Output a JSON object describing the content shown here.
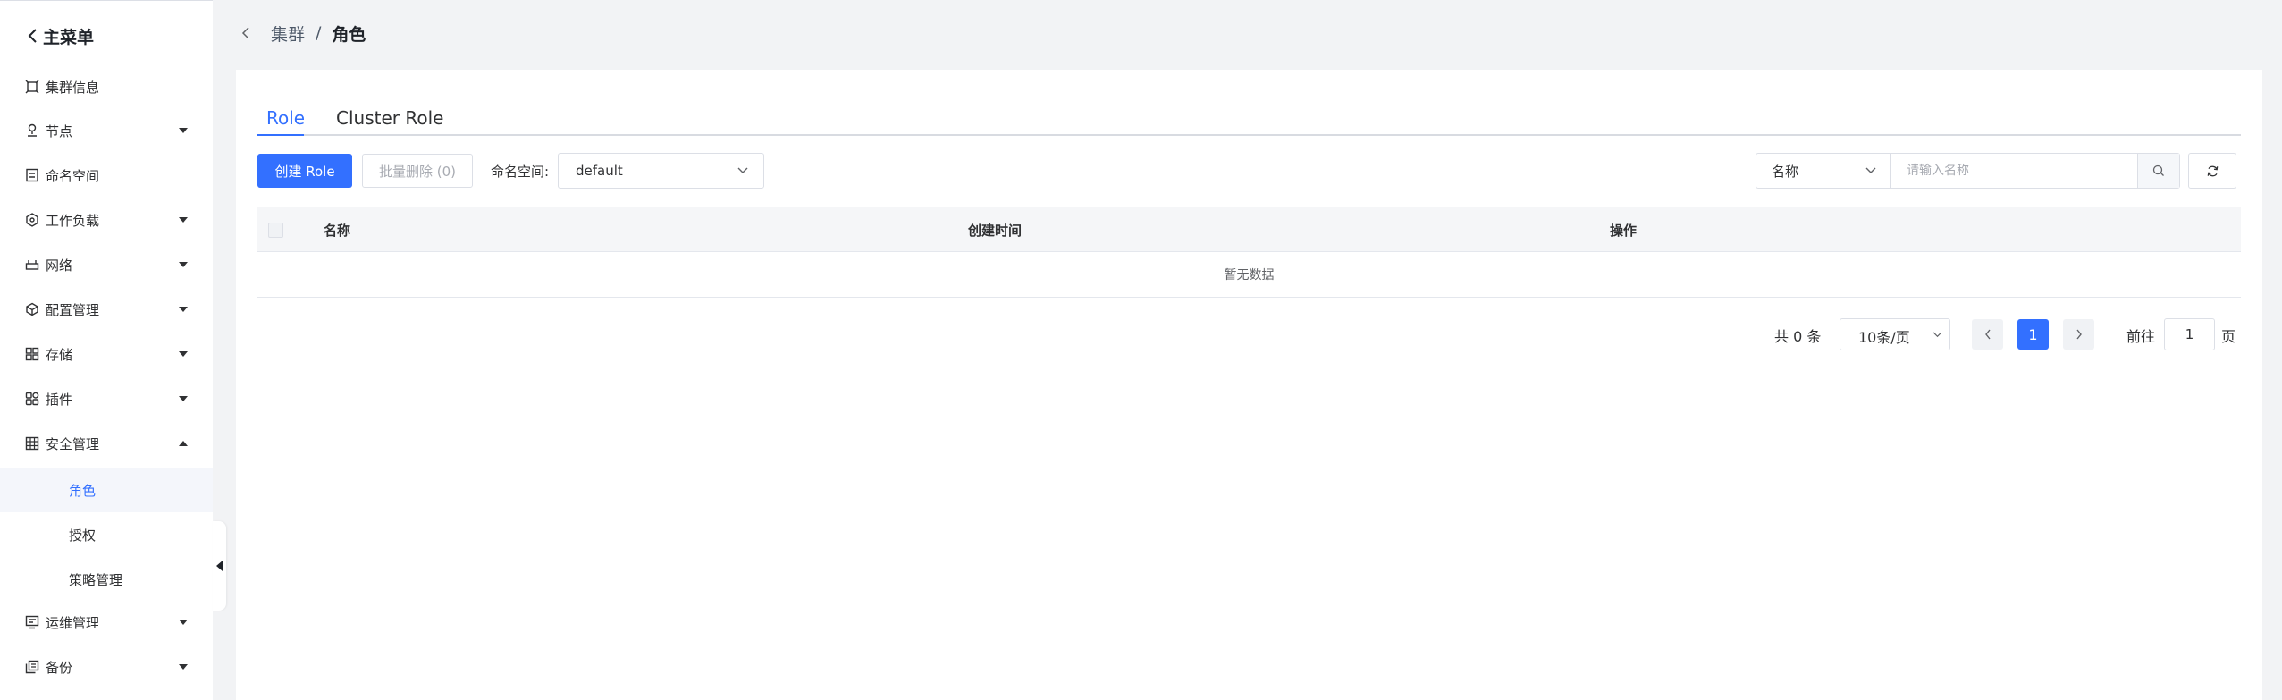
{
  "sidebar": {
    "main_menu_label": "主菜单",
    "items": [
      {
        "label": "集群信息",
        "icon": "cluster-info-icon",
        "has_caret": false
      },
      {
        "label": "节点",
        "icon": "node-icon",
        "has_caret": true
      },
      {
        "label": "命名空间",
        "icon": "namespace-icon",
        "has_caret": false
      },
      {
        "label": "工作负载",
        "icon": "workload-icon",
        "has_caret": true
      },
      {
        "label": "网络",
        "icon": "network-icon",
        "has_caret": true
      },
      {
        "label": "配置管理",
        "icon": "config-icon",
        "has_caret": true
      },
      {
        "label": "存储",
        "icon": "storage-icon",
        "has_caret": true
      },
      {
        "label": "插件",
        "icon": "plugin-icon",
        "has_caret": true
      },
      {
        "label": "安全管理",
        "icon": "security-icon",
        "has_caret": true,
        "expanded": true
      }
    ],
    "security_sub_items": [
      {
        "label": "角色",
        "active": true
      },
      {
        "label": "授权",
        "active": false
      },
      {
        "label": "策略管理",
        "active": false
      }
    ],
    "bottom_items": [
      {
        "label": "运维管理",
        "icon": "ops-icon",
        "has_caret": true
      },
      {
        "label": "备份",
        "icon": "backup-icon",
        "has_caret": true
      }
    ]
  },
  "breadcrumb": {
    "parent": "集群",
    "separator": "/",
    "current": "角色"
  },
  "tabs": [
    {
      "label": "Role",
      "active": true
    },
    {
      "label": "Cluster Role",
      "active": false
    }
  ],
  "toolbar": {
    "create_label": "创建 Role",
    "batch_delete_label": "批量删除 (0)",
    "namespace_label": "命名空间:",
    "namespace_value": "default",
    "search_field_value": "名称",
    "search_placeholder": "请输入名称"
  },
  "table": {
    "columns": [
      "名称",
      "创建时间",
      "操作"
    ],
    "empty_text": "暂无数据"
  },
  "pagination": {
    "total_text": "共 0 条",
    "page_size": "10条/页",
    "current_page": "1",
    "goto_label": "前往",
    "goto_value": "1",
    "goto_suffix": "页"
  },
  "colors": {
    "accent": "#3370ff",
    "sidebar_bg": "#ffffff",
    "page_bg": "#f2f3f5"
  }
}
